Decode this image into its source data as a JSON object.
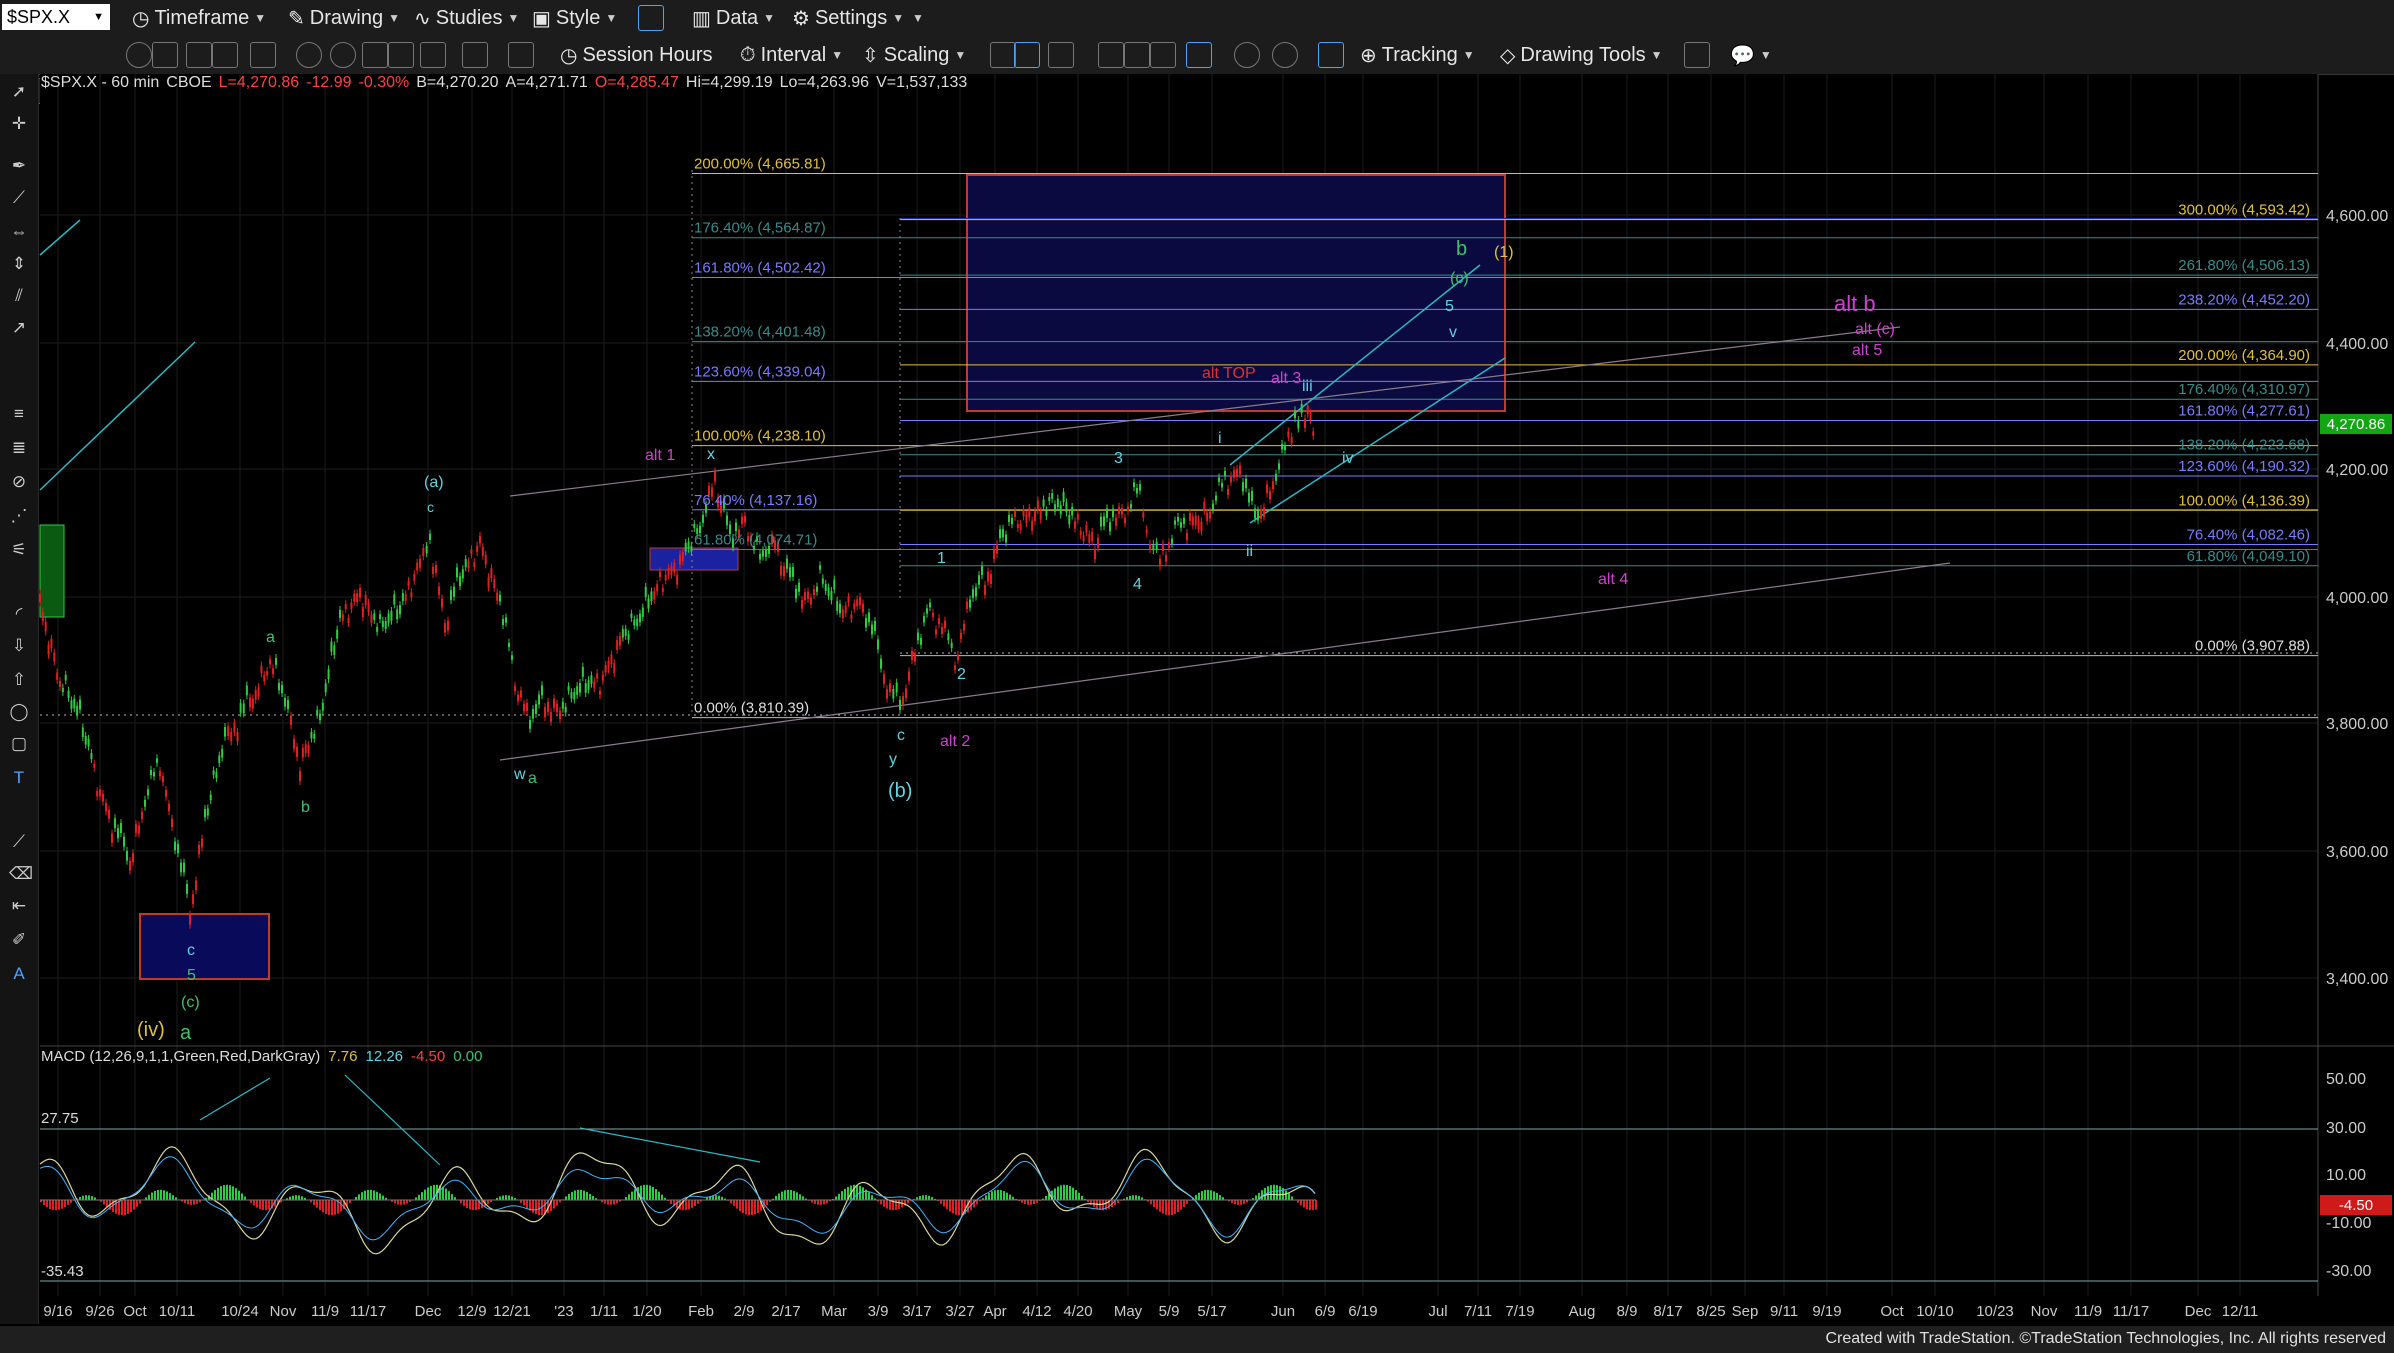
{
  "toolbar1": {
    "symbol": "$SPX.X",
    "timeframe": "Timeframe",
    "drawing": "Drawing",
    "studies": "Studies",
    "style": "Style",
    "data": "Data",
    "settings": "Settings"
  },
  "toolbar2": {
    "session_hours": "Session Hours",
    "interval": "Interval",
    "scaling": "Scaling",
    "tracking": "Tracking",
    "drawing_tools": "Drawing Tools"
  },
  "info": {
    "symbol": "$SPX.X - 60 min",
    "exchange": "CBOE",
    "last": "L=4,270.86",
    "change": "-12.99",
    "pct": "-0.30%",
    "bid": "B=4,270.20",
    "ask": "A=4,271.71",
    "open": "O=4,285.47",
    "high": "Hi=4,299.19",
    "low": "Lo=4,263.96",
    "volume": "V=1,537,133"
  },
  "macd": {
    "label": "MACD (12,26,9,1,1,Green,Red,DarkGray)",
    "v1": "7.76",
    "v2": "12.26",
    "v3": "-4.50",
    "v4": "0.00",
    "level_label": "27.75",
    "level_label2": "-35.43",
    "hist_label": "-4.50"
  },
  "price_axis": [
    "4,600.00",
    "4,400.00",
    "4,200.00",
    "4,000.00",
    "3,800.00",
    "3,600.00",
    "3,400.00"
  ],
  "macd_axis": [
    "50.00",
    "30.00",
    "10.00",
    "-10.00",
    "-30.00"
  ],
  "current_price": "4,270.86",
  "time_axis": [
    "9/16",
    "9/26",
    "Oct",
    "10/11",
    "10/24",
    "Nov",
    "11/9",
    "11/17",
    "Dec",
    "12/9",
    "12/21",
    "'23",
    "1/11",
    "1/20",
    "Feb",
    "2/9",
    "2/17",
    "Mar",
    "3/9",
    "3/17",
    "3/27",
    "Apr",
    "4/12",
    "4/20",
    "May",
    "5/9",
    "5/17",
    "Jun",
    "6/9",
    "6/19",
    "Jul",
    "7/11",
    "7/19",
    "Aug",
    "8/9",
    "8/17",
    "8/25",
    "Sep",
    "9/11",
    "9/19",
    "Oct",
    "10/10",
    "10/23",
    "Nov",
    "11/9",
    "11/17",
    "Dec",
    "12/11"
  ],
  "fib_left": [
    "200.00% (4,665.81)",
    "176.40% (4,564.87)",
    "161.80% (4,502.42)",
    "138.20% (4,401.48)",
    "123.60% (4,339.04)",
    "100.00% (4,238.10)",
    "76.40% (4,137.16)",
    "61.80% (4,074.71)",
    "0.00% (3,810.39)"
  ],
  "fib_right": [
    "300.00% (4,593.42)",
    "261.80% (4,506.13)",
    "238.20% (4,452.20)",
    "200.00% (4,364.90)",
    "176.40% (4,310.97)",
    "161.80% (4,277.61)",
    "138.20% (4,223.68)",
    "123.60% (4,190.32)",
    "100.00% (4,136.39)",
    "76.40% (4,082.46)",
    "61.80% (4,049.10)",
    "0.00% (3,907.88)"
  ],
  "wave_labels": {
    "a_top": "(a)",
    "c1": "c",
    "alt1": "alt 1",
    "x": "x",
    "w": "w",
    "a2": "a",
    "b_big": "(b)",
    "c2": "c",
    "y": "y",
    "alt2": "alt 2",
    "one": "1",
    "two": "2",
    "three": "3",
    "four": "4",
    "i": "i",
    "ii": "ii",
    "iii": "iii",
    "iv": "iv",
    "v": "v",
    "five": "5",
    "alt_top": "alt TOP",
    "alt3": "alt 3",
    "b_green": "b",
    "c_green": "(c)",
    "one_y": "(1)",
    "alt_b": "alt b",
    "alt_c": "alt (c)",
    "alt5": "alt 5",
    "alt4": "alt 4",
    "a_small": "a",
    "b_small": "b",
    "c_small": "c",
    "five_small": "5",
    "c_paren": "(c)",
    "iv_paren": "(iv)",
    "a_green": "a"
  },
  "footer": "Created with TradeStation. ©TradeStation Technologies, Inc. All rights reserved"
}
